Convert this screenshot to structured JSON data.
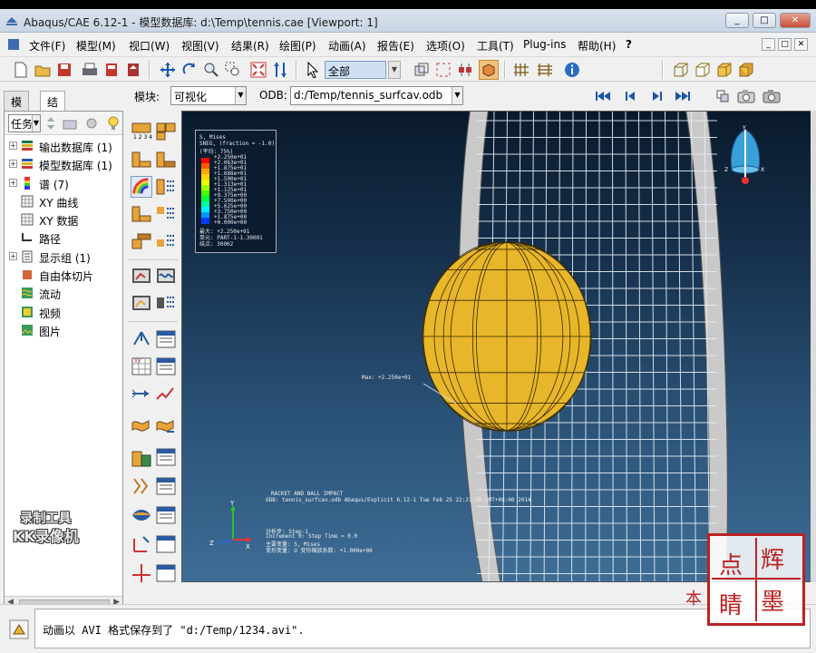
{
  "window": {
    "title": "Abaqus/CAE 6.12-1 - 模型数据库: d:\\Temp\\tennis.cae [Viewport: 1]",
    "controls": [
      "_",
      "□",
      "✕"
    ]
  },
  "menu": {
    "items": [
      "文件(F)",
      "模型(M)",
      "视口(W)",
      "视图(V)",
      "结果(R)",
      "绘图(P)",
      "动画(A)",
      "报告(E)",
      "选项(O)",
      "工具(T)",
      "Plug-ins",
      "帮助(H)",
      "?"
    ]
  },
  "toolbar": {
    "selection_filter": "全部"
  },
  "context": {
    "module_label": "模块:",
    "module_value": "可视化",
    "odb_label": "ODB:",
    "odb_value": "d:/Temp/tennis_surfcav.odb"
  },
  "left_tabs": [
    "模型",
    "结果"
  ],
  "tree": {
    "filter_value": "任务",
    "items": [
      {
        "label": "输出数据库 (1)",
        "expandable": true,
        "icon": "odb-icon"
      },
      {
        "label": "模型数据库 (1)",
        "expandable": true,
        "icon": "model-db-icon"
      },
      {
        "label": "谱 (7)",
        "expandable": true,
        "icon": "spectrum-icon"
      },
      {
        "label": "XY 曲线",
        "expandable": false,
        "icon": "xy-curve-icon"
      },
      {
        "label": "XY 数据",
        "expandable": false,
        "icon": "xy-data-icon"
      },
      {
        "label": "路径",
        "expandable": false,
        "icon": "path-icon"
      },
      {
        "label": "显示组 (1)",
        "expandable": true,
        "icon": "display-group-icon"
      },
      {
        "label": "自由体切片",
        "expandable": false,
        "icon": "free-body-icon"
      },
      {
        "label": "流动",
        "expandable": false,
        "icon": "stream-icon"
      },
      {
        "label": "视频",
        "expandable": false,
        "icon": "movie-icon"
      },
      {
        "label": "图片",
        "expandable": false,
        "icon": "image-icon"
      }
    ]
  },
  "viewport": {
    "legend": {
      "lines": [
        "S, Mises",
        "SNEG, (fraction = -1.0)",
        "(平均: 75%)",
        "+2.250e+01",
        "+2.063e+01",
        "+1.875e+01",
        "+1.688e+01",
        "+1.500e+01",
        "+1.313e+01",
        "+1.125e+01",
        "+9.375e+00",
        "+7.500e+00",
        "+5.625e+00",
        "+3.750e+00",
        "+1.875e+00",
        "+0.000e+00"
      ],
      "max_lines": [
        "最大: +2.250e+01",
        "单元: PART-1-1.30001",
        "结点: 30002"
      ],
      "colors": [
        "#ff0000",
        "#ff5a00",
        "#ffa500",
        "#ffd200",
        "#e6ff00",
        "#a0ff00",
        "#46ff00",
        "#00ff3c",
        "#00ffa0",
        "#00f0ff",
        "#0096ff",
        "#003cff"
      ]
    },
    "max_annotation": "Max: +2.250e+01",
    "info_lines": [
      "RACKET AND BALL IMPACT",
      "ODB: tennis_surfcav.odb    Abaqus/Explicit 6.12-1    Tue Feb 25 22:21:50 GMT+08:00 2014"
    ],
    "step_lines": [
      "分析步: Step-1",
      "Increment    0: Step Time = 0.0",
      "主要变量: S, Mises",
      "变形变量: U  变形缩放系数: +1.000e+00"
    ],
    "triad": {
      "x": "X",
      "y": "Y",
      "z": "Z"
    }
  },
  "message": "动画以 AVI 格式保存到了 \"d:/Temp/1234.avi\".",
  "overlay": {
    "watermark_lines": [
      "录制工具",
      "KK录像机"
    ],
    "seal_chars": [
      "点",
      "辉",
      "睛",
      "墨"
    ],
    "seal_side_text": "本"
  }
}
